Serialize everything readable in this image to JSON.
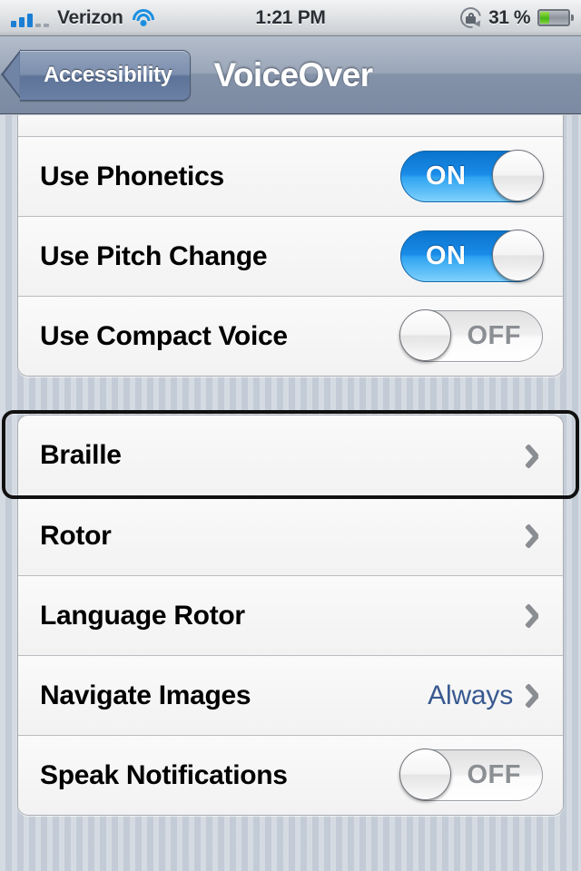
{
  "status_bar": {
    "signal_icon": "cellular-signal-icon",
    "signal_bars_filled": 3,
    "signal_bars_total": 5,
    "carrier": "Verizon",
    "wifi_icon": "wifi-icon",
    "time": "1:21 PM",
    "rotation_lock_icon": "rotation-lock-icon",
    "battery_percent": "31 %",
    "battery_level": 31,
    "battery_icon": "battery-icon"
  },
  "nav_bar": {
    "back_label": "Accessibility",
    "back_icon": "back-chevron-icon",
    "title": "VoiceOver"
  },
  "groups": [
    {
      "name": "speech-options-group",
      "clipped_top": true,
      "cells": [
        {
          "type": "partial",
          "title": ""
        },
        {
          "type": "switch",
          "title": "Use Phonetics",
          "switch_state": "ON",
          "switch_on": true
        },
        {
          "type": "switch",
          "title": "Use Pitch Change",
          "switch_state": "ON",
          "switch_on": true
        },
        {
          "type": "switch",
          "title": "Use Compact Voice",
          "switch_state": "OFF",
          "switch_on": false
        }
      ]
    },
    {
      "name": "navigation-options-group",
      "clipped_top": false,
      "cells": [
        {
          "type": "disclosure",
          "title": "Braille",
          "value": "",
          "focused": true
        },
        {
          "type": "disclosure",
          "title": "Rotor",
          "value": "",
          "focused": false
        },
        {
          "type": "disclosure",
          "title": "Language Rotor",
          "value": "",
          "focused": false
        },
        {
          "type": "disclosure",
          "title": "Navigate Images",
          "value": "Always",
          "focused": false
        },
        {
          "type": "switch",
          "title": "Speak Notifications",
          "switch_state": "OFF",
          "switch_on": false
        }
      ]
    }
  ],
  "colors": {
    "accent_blue": "#1a8ce8",
    "value_blue": "#38598f",
    "pinstripe_bg": "#c3cbd6",
    "nav_bar_top": "#b4bdcb",
    "nav_bar_bottom": "#7b8aa2",
    "focus_cursor": "#111111",
    "battery_green": "#47b614"
  }
}
